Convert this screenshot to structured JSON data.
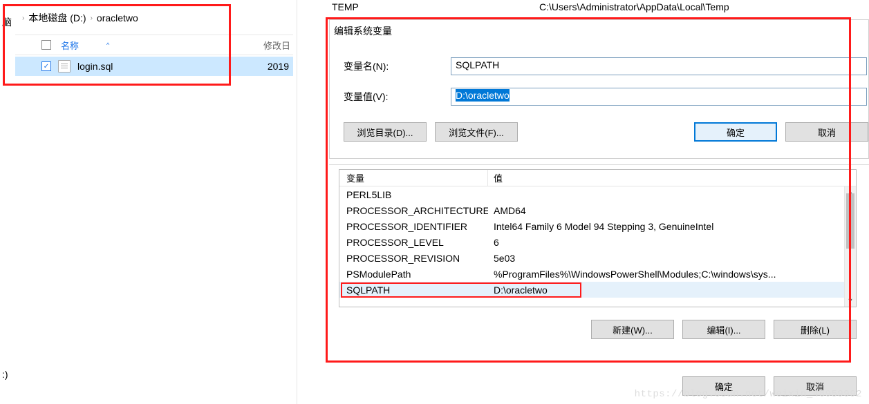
{
  "explorer": {
    "sidebar_label": "脑",
    "sidebar_bottom": ":)",
    "breadcrumb": {
      "seg1": "本地磁盘 (D:)",
      "seg2": "oracletwo"
    },
    "header": {
      "name": "名称",
      "modified": "修改日"
    },
    "file": {
      "name": "login.sql",
      "date": "2019"
    }
  },
  "top_row": {
    "var": "TEMP",
    "val": "C:\\Users\\Administrator\\AppData\\Local\\Temp"
  },
  "dialog": {
    "title": "编辑系统变量",
    "name_label": "变量名(N):",
    "name_value": "SQLPATH",
    "value_label": "变量值(V):",
    "value_value": "D:\\oracletwo",
    "browse_dir": "浏览目录(D)...",
    "browse_file": "浏览文件(F)...",
    "ok": "确定",
    "cancel": "取消"
  },
  "env": {
    "header": {
      "var": "变量",
      "val": "值"
    },
    "rows": [
      {
        "var": "PERL5LIB",
        "val": ""
      },
      {
        "var": "PROCESSOR_ARCHITECTURE",
        "val": "AMD64"
      },
      {
        "var": "PROCESSOR_IDENTIFIER",
        "val": "Intel64 Family 6 Model 94 Stepping 3, GenuineIntel"
      },
      {
        "var": "PROCESSOR_LEVEL",
        "val": "6"
      },
      {
        "var": "PROCESSOR_REVISION",
        "val": "5e03"
      },
      {
        "var": "PSModulePath",
        "val": "%ProgramFiles%\\WindowsPowerShell\\Modules;C:\\windows\\sys..."
      },
      {
        "var": "SQLPATH",
        "val": "D:\\oracletwo"
      }
    ],
    "new_btn": "新建(W)...",
    "edit_btn": "编辑(I)...",
    "delete_btn": "删除(L)",
    "ok": "确定",
    "cancel": "取消"
  },
  "watermark": "https://blog.csdn.net/weixin_46959992"
}
